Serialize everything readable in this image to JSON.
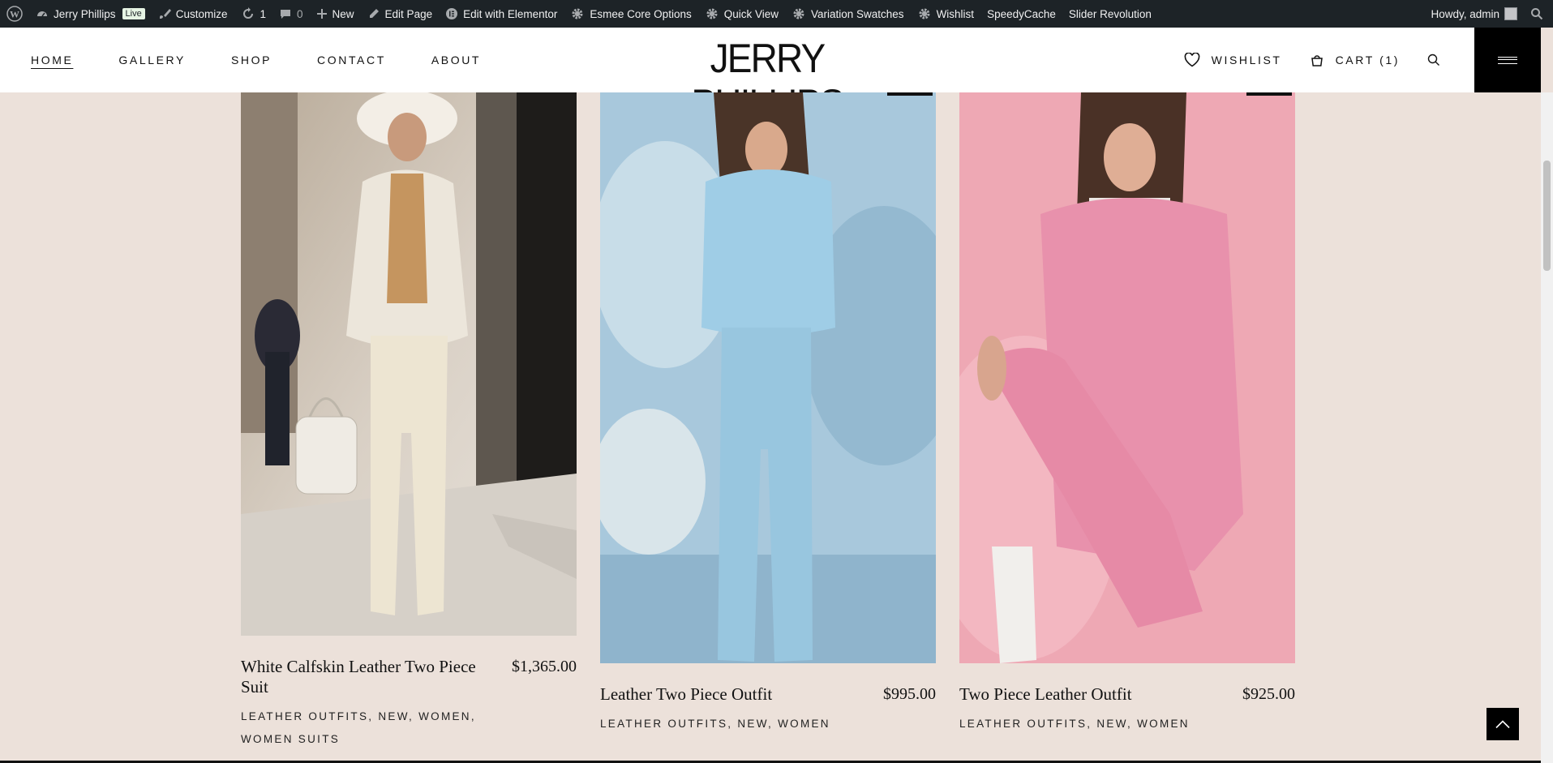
{
  "adminbar": {
    "site_name": "Jerry Phillips",
    "live_badge": "Live",
    "customize": "Customize",
    "updates_count": "1",
    "comments_count": "0",
    "new": "New",
    "edit_page": "Edit Page",
    "edit_elementor": "Edit with Elementor",
    "esmee": "Esmee Core Options",
    "quick_view": "Quick View",
    "variation": "Variation Swatches",
    "wishlist": "Wishlist",
    "speedycache": "SpeedyCache",
    "slider": "Slider Revolution",
    "howdy": "Howdy, admin"
  },
  "header": {
    "nav": [
      "HOME",
      "GALLERY",
      "SHOP",
      "CONTACT",
      "ABOUT"
    ],
    "logo": "JERRY PHILLIPS",
    "wishlist": "WISHLIST",
    "cart": "CART (1)"
  },
  "products": [
    {
      "title": "White Calfskin Leather Two Piece Suit",
      "price": "$1,365.00",
      "categories": "LEATHER OUTFITS, NEW, WOMEN, WOMEN SUITS"
    },
    {
      "title": "Leather Two Piece Outfit",
      "price": "$995.00",
      "categories": "LEATHER OUTFITS, NEW, WOMEN"
    },
    {
      "title": "Two Piece Leather Outfit",
      "price": "$925.00",
      "categories": "LEATHER OUTFITS, NEW, WOMEN"
    }
  ],
  "colors": {
    "page_bg": "#ece1da",
    "adminbar_bg": "#1d2327",
    "accent": "#000000"
  }
}
